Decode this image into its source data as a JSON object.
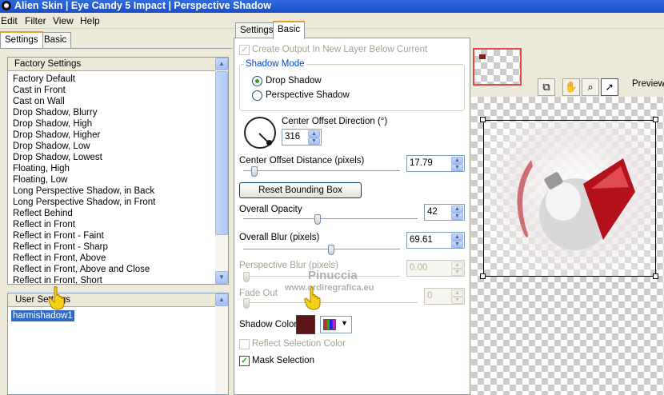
{
  "window": {
    "title": "Alien Skin | Eye Candy 5 Impact | Perspective Shadow"
  },
  "menu": [
    "Edit",
    "Filter",
    "View",
    "Help"
  ],
  "left_tabs": [
    "Settings",
    "Basic"
  ],
  "factory_settings": {
    "header": "Factory Settings",
    "items": [
      "Factory Default",
      "Cast in Front",
      "Cast on Wall",
      "Drop Shadow, Blurry",
      "Drop Shadow, High",
      "Drop Shadow, Higher",
      "Drop Shadow, Low",
      "Drop Shadow, Lowest",
      "Floating, High",
      "Floating, Low",
      "Long Perspective Shadow, in Back",
      "Long Perspective Shadow, in Front",
      "Reflect Behind",
      "Reflect in Front",
      "Reflect in Front - Faint",
      "Reflect in Front - Sharp",
      "Reflect in Front, Above",
      "Reflect in Front, Above and Close",
      "Reflect in Front, Short"
    ]
  },
  "user_settings": {
    "header": "User Settings",
    "items": [
      "harmishadow1"
    ]
  },
  "mid_tabs": [
    "Settings",
    "Basic"
  ],
  "basic": {
    "create_output": "Create Output In New Layer Below Current",
    "shadow_mode_label": "Shadow Mode",
    "mode_drop": "Drop Shadow",
    "mode_perspective": "Perspective Shadow",
    "center_offset_direction": {
      "label": "Center Offset Direction (°)",
      "value": "316"
    },
    "center_offset_distance": {
      "label": "Center Offset Distance (pixels)",
      "value": "17.79"
    },
    "reset_button": "Reset Bounding Box",
    "overall_opacity": {
      "label": "Overall Opacity",
      "value": "42"
    },
    "overall_blur": {
      "label": "Overall Blur (pixels)",
      "value": "69.61"
    },
    "perspective_blur": {
      "label": "Perspective Blur (pixels)",
      "value": "0.00"
    },
    "fade_out": {
      "label": "Fade Out",
      "value": "0"
    },
    "shadow_color_label": "Shadow Color",
    "shadow_color": "#5c1414",
    "reflect_selection_color": "Reflect Selection Color",
    "mask_selection": "Mask Selection"
  },
  "preview": {
    "label": "Preview"
  },
  "watermark": {
    "name": "Pinuccia",
    "url": "www.ordiregrafica.eu"
  }
}
